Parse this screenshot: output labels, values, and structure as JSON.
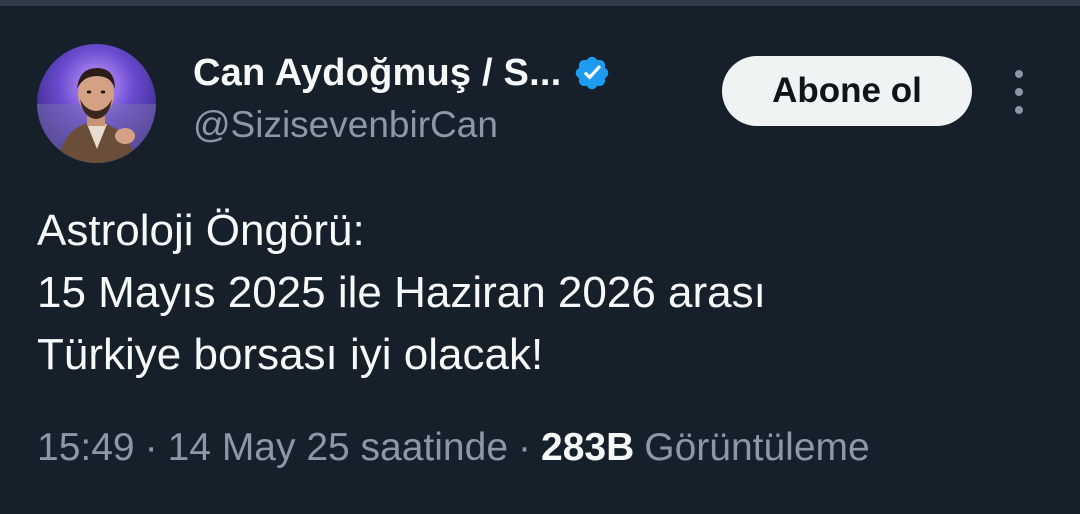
{
  "author": {
    "display_name": "Can Aydoğmuş / S...",
    "handle": "@SizisevenbirCan",
    "verified_icon": "verified-badge-icon",
    "avatar_icon": "user-avatar"
  },
  "actions": {
    "follow_label": "Abone ol",
    "more_icon": "more-options-icon"
  },
  "tweet": {
    "lines": [
      "Astroloji Öngörü:",
      "15 Mayıs 2025 ile Haziran 2026 arası",
      "Türkiye borsası iyi olacak!"
    ]
  },
  "meta": {
    "time": "15:49",
    "separator": "·",
    "date": "14 May 25 saatinde",
    "views_count": "283B",
    "views_label": "Görüntüleme"
  },
  "colors": {
    "background": "#15202b",
    "text_primary": "#f7f9f9",
    "text_secondary": "#8b98a5",
    "verified_blue": "#1d9bf0",
    "button_bg": "#eff3f4"
  }
}
